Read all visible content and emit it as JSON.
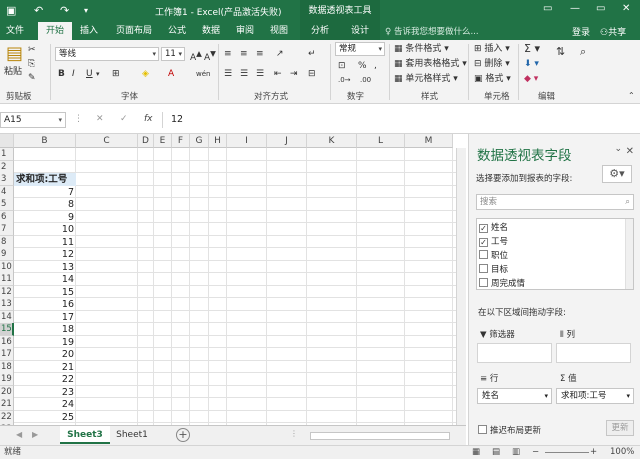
{
  "window": {
    "title": "工作簿1 - Excel(产品激活失败)",
    "context_group": "数据透视表工具",
    "minimize": "—",
    "restore": "▭",
    "close": "✕"
  },
  "tabs": [
    "文件",
    "开始",
    "插入",
    "页面布局",
    "公式",
    "数据",
    "审阅",
    "视图",
    "分析",
    "设计"
  ],
  "tell_me": "告诉我您想要做什么...",
  "login": "登录",
  "share": "共享",
  "ribbon": {
    "paste": "粘贴",
    "font_name": "等线",
    "font_size": "11",
    "number_format": "常规",
    "cond_format": "条件格式",
    "table_format": "套用表格格式",
    "cell_style": "单元格样式",
    "insert": "插入",
    "delete": "删除",
    "format": "格式",
    "groups": {
      "clipboard": "剪贴板",
      "font": "字体",
      "alignment": "对齐方式",
      "number": "数字",
      "styles": "样式",
      "cells": "单元格",
      "editing": "编辑"
    }
  },
  "formula_bar": {
    "name_box": "A15",
    "fx": "fx",
    "value": "12"
  },
  "grid": {
    "columns": [
      "B",
      "C",
      "D",
      "E",
      "F",
      "G",
      "H",
      "I",
      "J",
      "K",
      "L",
      "M"
    ],
    "rows": [
      "1",
      "2",
      "3",
      "4",
      "5",
      "6",
      "7",
      "8",
      "9",
      "10",
      "11",
      "12",
      "13",
      "14",
      "15",
      "16",
      "17",
      "18",
      "19",
      "20",
      "21",
      "22",
      "23"
    ],
    "selected_row": "15",
    "header_cell": "求和项:工号",
    "values": [
      "7",
      "8",
      "9",
      "10",
      "11",
      "12",
      "13",
      "14",
      "15",
      "16",
      "17",
      "18",
      "19",
      "20",
      "21",
      "22",
      "23",
      "24",
      "25"
    ]
  },
  "sheets": {
    "tabs": [
      "Sheet3",
      "Sheet1"
    ],
    "active": "Sheet3",
    "add": "+"
  },
  "status": {
    "ready": "就绪",
    "zoom": "100%"
  },
  "pivot_pane": {
    "title": "数据透视表字段",
    "choose_label": "选择要添加到报表的字段:",
    "search_placeholder": "搜索",
    "fields": [
      {
        "name": "姓名",
        "checked": true
      },
      {
        "name": "工号",
        "checked": true
      },
      {
        "name": "职位",
        "checked": false
      },
      {
        "name": "目标",
        "checked": false
      },
      {
        "name": "周完成情",
        "checked": false
      }
    ],
    "drag_label": "在以下区域间拖动字段:",
    "areas": {
      "filters": "筛选器",
      "columns": "列",
      "rows": "行",
      "values": "值"
    },
    "rows_item": "姓名",
    "values_item": "求和项:工号",
    "defer_label": "推迟布局更新",
    "update": "更新"
  }
}
